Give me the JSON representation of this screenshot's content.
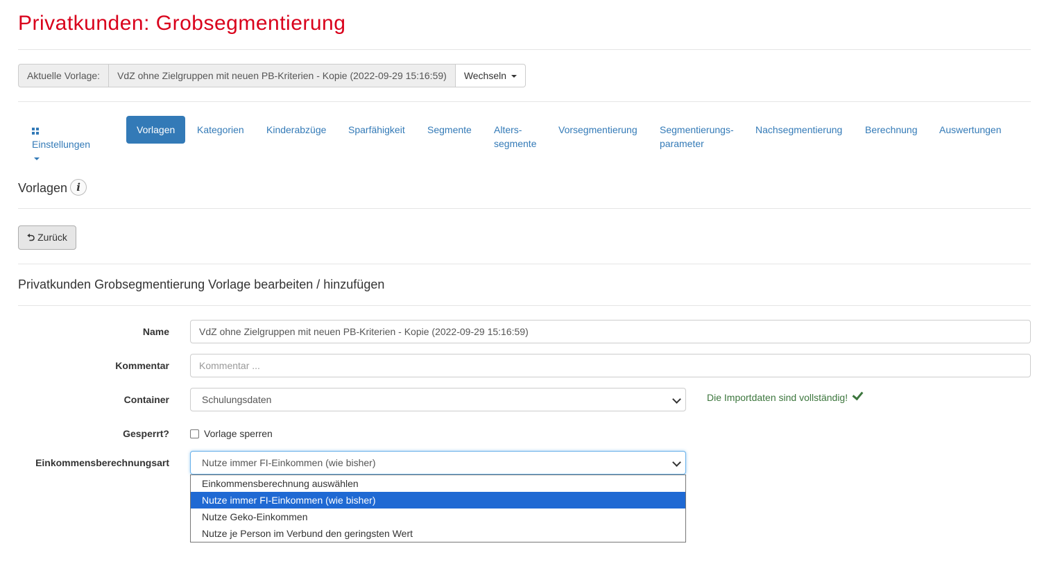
{
  "page_title": "Privatkunden: Grobsegmentierung",
  "template_bar": {
    "addon_label": "Aktuelle Vorlage:",
    "current_template": "VdZ ohne Zielgruppen mit neuen PB-Kriterien - Kopie (2022-09-29 15:16:59)",
    "switch_label": "Wechseln"
  },
  "nav": {
    "settings": "Einstellungen",
    "templates": "Vorlagen",
    "categories": "Kategorien",
    "child_deductions": "Kinderabzüge",
    "savings_ability": "Sparfähigkeit",
    "segments": "Segmente",
    "age_segments_1": "Alters-",
    "age_segments_2": "segmente",
    "pre_segmentation": "Vorsegmentierung",
    "seg_params_1": "Segmentierungs-",
    "seg_params_2": "parameter",
    "post_segmentation": "Nachsegmentierung",
    "calculation": "Berechnung",
    "evaluations": "Auswertungen"
  },
  "section_title": "Vorlagen",
  "back_label": "Zurück",
  "form": {
    "title": "Privatkunden Grobsegmentierung Vorlage bearbeiten / hinzufügen",
    "name_label": "Name",
    "name_value": "VdZ ohne Zielgruppen mit neuen PB-Kriterien - Kopie (2022-09-29 15:16:59)",
    "comment_label": "Kommentar",
    "comment_placeholder": "Kommentar ...",
    "container_label": "Container",
    "container_value": "Schulungsdaten",
    "import_status": "Die Importdaten sind vollständig!",
    "locked_label": "Gesperrt?",
    "locked_checkbox_label": "Vorlage sperren",
    "locked_checked": false,
    "income_label": "Einkommensberechnungsart",
    "income_value": "Nutze immer FI-Einkommen (wie bisher)",
    "income_options": [
      "Einkommensberechnung auswählen",
      "Nutze immer FI-Einkommen (wie bisher)",
      "Nutze Geko-Einkommen",
      "Nutze je Person im Verbund den geringsten Wert"
    ]
  },
  "colors": {
    "title_red": "#d9001b",
    "link_blue": "#337ab7",
    "success_green": "#3c763d",
    "selected_option": "#1f69d3"
  }
}
